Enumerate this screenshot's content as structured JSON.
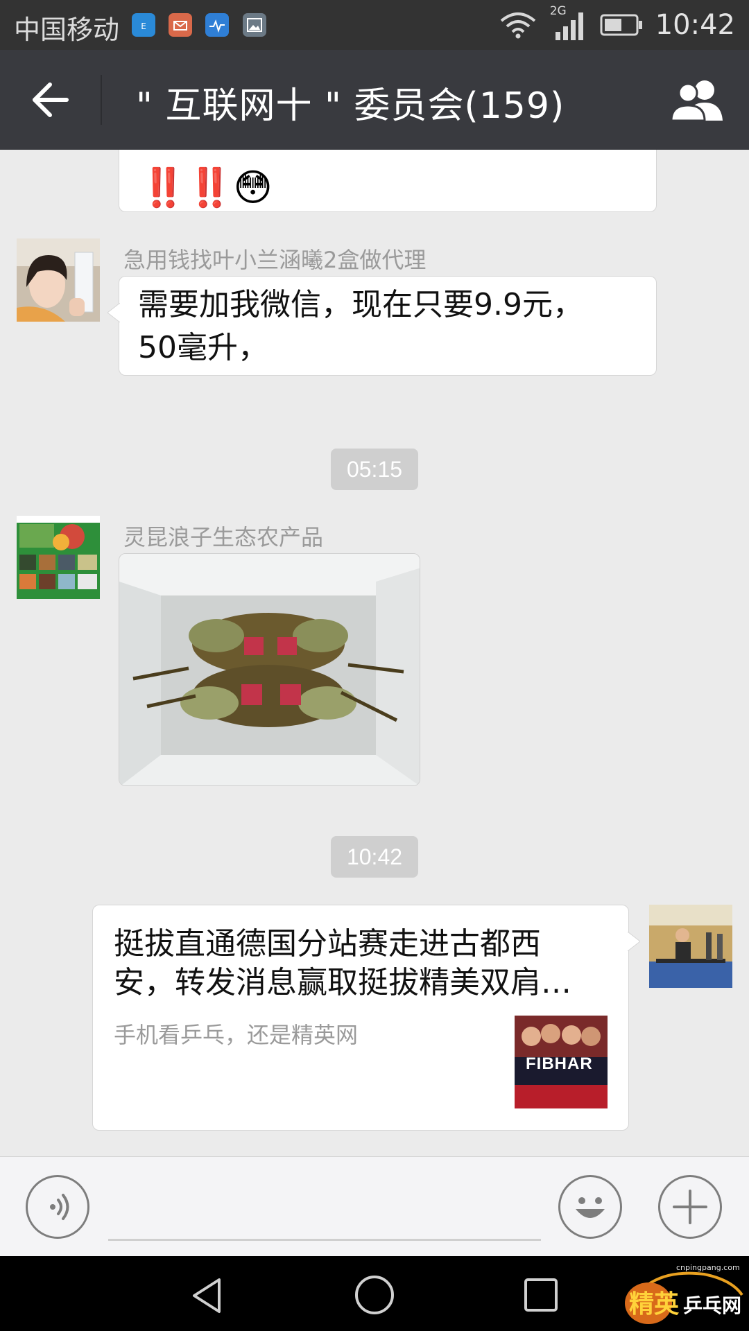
{
  "status_bar": {
    "carrier": "中国移动",
    "network": "2G",
    "time": "10:42",
    "app_icons": [
      "email-app-icon",
      "mail-app-icon",
      "health-app-icon",
      "gallery-app-icon"
    ]
  },
  "header": {
    "title": "\" 互联网十 \" 委员会(159)"
  },
  "messages": {
    "m1": {
      "emoji_text": "‼️‼️😳"
    },
    "m2": {
      "sender": "急用钱找叶小兰涵曦2盒做代理",
      "text_line1": "需要加我微信，现在只要9.9元，",
      "text_line2": "50毫升，"
    },
    "time1": "05:15",
    "m3": {
      "sender": "灵昆浪子生态农产品"
    },
    "time2": "10:42",
    "m4": {
      "title_line1": "挺拔直通德国分站赛走进古都西",
      "title_line2": "安，转发消息赢取挺拔精美双肩…",
      "description": "手机看乒乓，还是精英网",
      "thumb_text": "FIBHAR"
    }
  },
  "watermark": {
    "brand_left": "精英",
    "brand_right": "乒乓网",
    "url": "cnpingpang.com"
  },
  "colors": {
    "header_bg": "#393a3f",
    "status_bg": "#333333",
    "chat_bg": "#ebebeb",
    "time_chip": "#cfcfcf"
  }
}
